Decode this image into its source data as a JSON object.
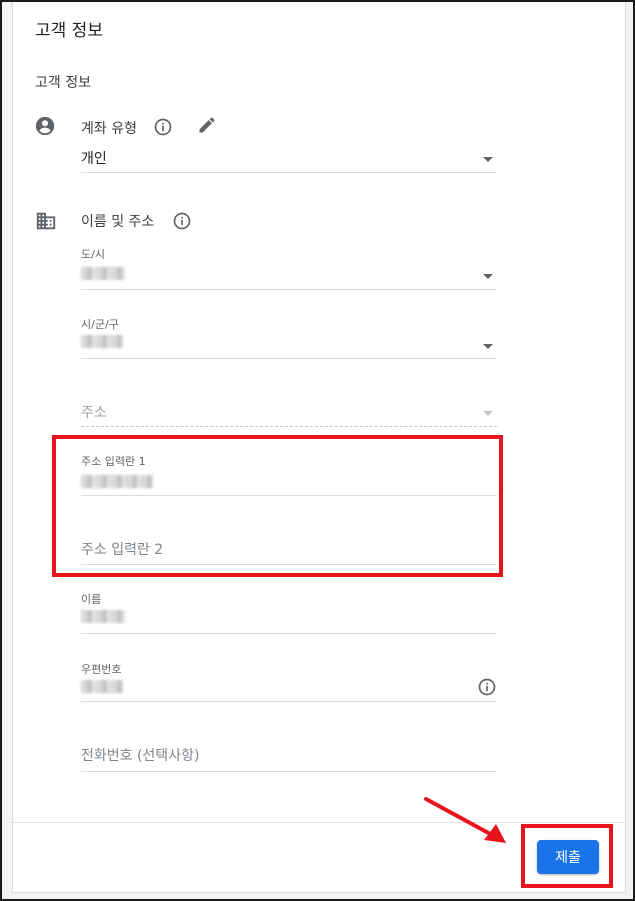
{
  "dialog": {
    "title": "고객 정보"
  },
  "section": {
    "title": "고객 정보"
  },
  "account_type": {
    "label": "계좌 유형",
    "value": "개인",
    "icons": [
      "account-circle-icon",
      "info-icon",
      "edit-pencil-icon"
    ]
  },
  "name_address": {
    "label": "이름 및 주소",
    "icons": [
      "building-icon",
      "info-icon"
    ]
  },
  "fields": {
    "province": {
      "label": "도/시"
    },
    "city": {
      "label": "시/군/구"
    },
    "address": {
      "placeholder": "주소"
    },
    "address_line1": {
      "label": "주소 입력란 1"
    },
    "address_line2": {
      "placeholder": "주소 입력란 2"
    },
    "name": {
      "label": "이름"
    },
    "postal_code": {
      "label": "우편번호"
    },
    "phone": {
      "placeholder": "전화번호 (선택사항)"
    }
  },
  "footer": {
    "submit_label": "제출"
  },
  "colors": {
    "accent": "#1a73e8",
    "highlight": "#e8141b",
    "divider": "#dadce0"
  }
}
